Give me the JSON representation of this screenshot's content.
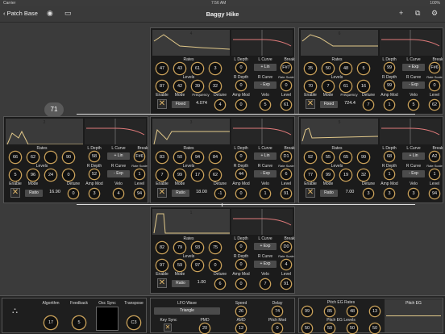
{
  "status": {
    "carrier": "Carrier",
    "time": "7:56 AM",
    "battery": "100%"
  },
  "nav": {
    "back": "Patch Base",
    "title": "Baggy Hike"
  },
  "badge": "71",
  "labels": {
    "rates": "Rates",
    "levels": "Levels",
    "enable": "Enable",
    "mode": "Mode",
    "detune": "Detune",
    "amp_mod": "Amp Mod",
    "velo": "Velo",
    "level": "Level",
    "l_depth": "L Depth",
    "l_curve": "L Curve",
    "break": "Break",
    "r_depth": "R Depth",
    "r_curve": "R Curve",
    "rate_scale": "Rate Scale",
    "frequency": "Frequency"
  },
  "ops": [
    {
      "num": "4",
      "rates": [
        "47",
        "43",
        "61",
        "3"
      ],
      "levels": [
        "87",
        "42",
        "39",
        "32"
      ],
      "mode": "Fixed",
      "freq": "4.074",
      "detune": "4",
      "l_depth": "0",
      "l_curve": "+ Lin",
      "break": "F#7",
      "r_depth": "0",
      "r_curve": "- Exp",
      "rate_scale": "0",
      "amp_mod": "0",
      "velo": "5",
      "level": "61",
      "enabled": true
    },
    {
      "num": "6",
      "rates": [
        "35",
        "50",
        "48",
        "5"
      ],
      "levels": [
        "70",
        "7",
        "61",
        "16"
      ],
      "mode": "Fixed",
      "freq": "724.4",
      "detune": "7",
      "l_depth": "99",
      "l_curve": "+ Exp",
      "break": "F#6",
      "r_depth": "99",
      "r_curve": "- Exp",
      "rate_scale": "0",
      "amp_mod": "1",
      "velo": "5",
      "level": "62",
      "enabled": true
    },
    {
      "num": "2",
      "rates": [
        "66",
        "62",
        "",
        "90"
      ],
      "levels": [
        "5",
        "96",
        "24",
        "0"
      ],
      "mode": "Ratio",
      "freq": "16.90",
      "detune": "0",
      "l_depth": "58",
      "l_curve": "+ Lin",
      "break": "F#6",
      "r_depth": "52",
      "r_curve": "- Exp",
      "rate_scale": "1",
      "amp_mod": "3",
      "velo": "4",
      "level": "94",
      "enabled": true
    },
    {
      "num": "3",
      "rates": [
        "83",
        "50",
        "94",
        "84"
      ],
      "levels": [
        "7",
        "99",
        "17",
        "62"
      ],
      "mode": "Ratio",
      "freq": "18.00",
      "detune": "-1",
      "l_depth": "0",
      "l_curve": "+ Lin",
      "break": "D1",
      "r_depth": "44",
      "r_curve": "- Exp",
      "rate_scale": "6",
      "amp_mod": "0",
      "velo": "1",
      "level": "91",
      "enabled": true
    },
    {
      "num": "5",
      "rates": [
        "92",
        "55",
        "65",
        "99"
      ],
      "levels": [
        "77",
        "99",
        "19",
        "32"
      ],
      "mode": "Ratio",
      "freq": "7.00",
      "detune": "3",
      "l_depth": "68",
      "l_curve": "+ Lin",
      "break": "A2",
      "r_depth": "1",
      "r_curve": "- Exp",
      "rate_scale": "1",
      "amp_mod": "3",
      "velo": "3",
      "level": "94",
      "enabled": true
    },
    {
      "num": "1",
      "rates": [
        "82",
        "79",
        "93",
        "75"
      ],
      "levels": [
        "97",
        "59",
        "97",
        "0"
      ],
      "mode": "Ratio",
      "freq": "1.00",
      "detune": "6",
      "l_depth": "0",
      "l_curve": "+ Exp",
      "break": "D0",
      "r_depth": "0",
      "r_curve": "+ Exp",
      "rate_scale": "4",
      "amp_mod": "0",
      "velo": "7",
      "level": "91",
      "enabled": true
    }
  ],
  "bottom": {
    "algorithm_label": "Algorithm",
    "algorithm": "17",
    "feedback_label": "Feedback",
    "feedback": "5",
    "osc_sync_label": "Osc Sync",
    "transpose_label": "Transpose",
    "transpose": "C3",
    "lfo_wave_label": "LFO Wave",
    "lfo_wave": "Triangle",
    "key_sync_label": "Key Sync",
    "pmd_label": "PMD",
    "pmd": "20",
    "speed_label": "Speed",
    "speed": "26",
    "delay_label": "Delay",
    "delay": "74",
    "amd_label": "AMD",
    "amd": "12",
    "pitch_mod_label": "Pitch Mod",
    "pitch_mod": "0",
    "pitch_eg_rates_label": "Pitch EG Rates",
    "pitch_eg_rates": [
      "99",
      "85",
      "48",
      "13"
    ],
    "pitch_eg_levels_label": "Pitch EG Levels",
    "pitch_eg_levels": [
      "50",
      "50",
      "50",
      "50"
    ],
    "pitch_eg_label": "Pitch EG"
  },
  "colors": {
    "accent": "#c9a15a",
    "env": "#e2c98a",
    "ks": "#e07a7a"
  }
}
